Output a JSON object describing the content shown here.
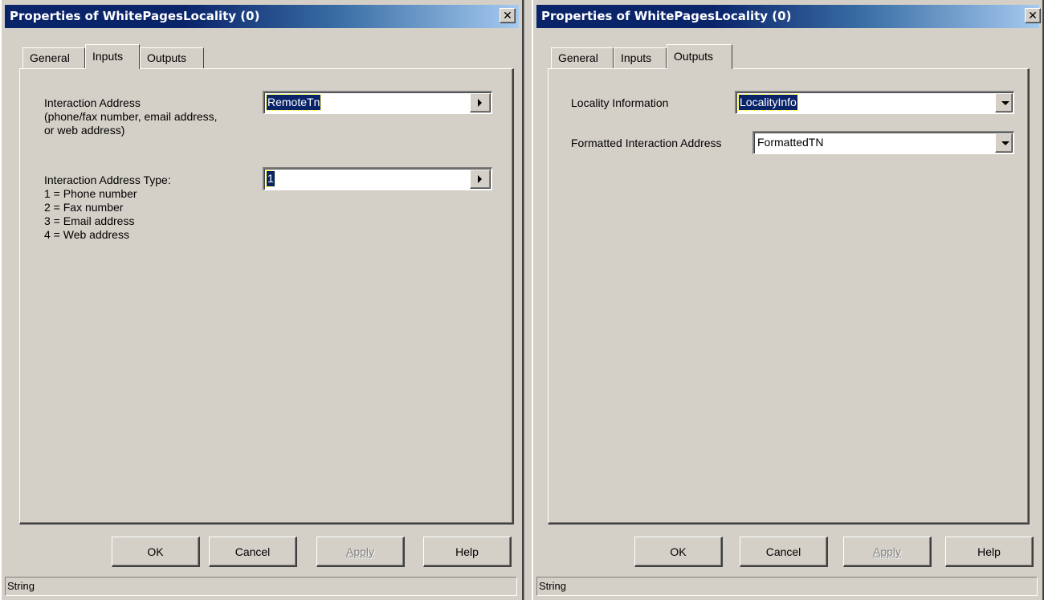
{
  "left_dialog": {
    "title": "Properties of WhitePagesLocality (0)",
    "close_glyph": "✕",
    "tabs": [
      {
        "label": "General",
        "active": false
      },
      {
        "label": "Inputs",
        "active": true
      },
      {
        "label": "Outputs",
        "active": false
      }
    ],
    "fields": [
      {
        "label_lines": [
          "Interaction Address",
          "(phone/fax number, email address,",
          "or web address)"
        ],
        "value": "RemoteTn",
        "button_icon": "arrow-right-icon"
      },
      {
        "label_lines": [
          "Interaction Address Type:",
          "1 = Phone number",
          "2 = Fax number",
          "3 = Email address",
          "4 = Web address"
        ],
        "value": "1",
        "button_icon": "arrow-right-icon"
      }
    ],
    "buttons": {
      "ok": "OK",
      "cancel": "Cancel",
      "apply": "Apply",
      "help": "Help"
    },
    "status": "String"
  },
  "right_dialog": {
    "title": "Properties of WhitePagesLocality (0)",
    "close_glyph": "✕",
    "tabs": [
      {
        "label": "General",
        "active": false
      },
      {
        "label": "Inputs",
        "active": false
      },
      {
        "label": "Outputs",
        "active": true
      }
    ],
    "fields": [
      {
        "label": "Locality Information",
        "value": "LocalityInfo",
        "button_icon": "dropdown-arrow-icon"
      },
      {
        "label": "Formatted Interaction Address",
        "value": "FormattedTN",
        "button_icon": "dropdown-arrow-icon"
      }
    ],
    "buttons": {
      "ok": "OK",
      "cancel": "Cancel",
      "apply": "Apply",
      "help": "Help"
    },
    "status": "String"
  },
  "colors": {
    "titlebar_start": "#0a246a",
    "titlebar_end": "#a6caf0",
    "face": "#d4d0c8",
    "selection": "#0a246a"
  }
}
